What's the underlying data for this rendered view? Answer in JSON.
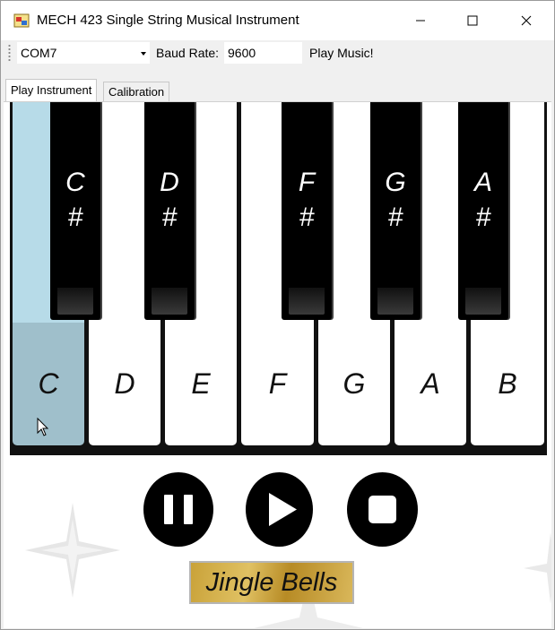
{
  "window": {
    "title": "MECH 423 Single String Musical Instrument",
    "minimize_icon": "minimize-icon",
    "maximize_icon": "maximize-icon",
    "close_icon": "close-icon"
  },
  "toolbar": {
    "port_value": "COM7",
    "baud_label": "Baud Rate:",
    "baud_value": "9600",
    "play_label": "Play Music!"
  },
  "tabs": [
    {
      "label": "Play Instrument",
      "active": true
    },
    {
      "label": "Calibration",
      "active": false
    }
  ],
  "keyboard": {
    "white_keys": [
      {
        "note": "C",
        "pressed": true
      },
      {
        "note": "D",
        "pressed": false
      },
      {
        "note": "E",
        "pressed": false
      },
      {
        "note": "F",
        "pressed": false
      },
      {
        "note": "G",
        "pressed": false
      },
      {
        "note": "A",
        "pressed": false
      },
      {
        "note": "B",
        "pressed": false
      }
    ],
    "black_keys": [
      {
        "note": "C",
        "sharp": "#"
      },
      {
        "note": "D",
        "sharp": "#"
      },
      {
        "note": "F",
        "sharp": "#"
      },
      {
        "note": "G",
        "sharp": "#"
      },
      {
        "note": "A",
        "sharp": "#"
      }
    ]
  },
  "controls": {
    "pause_icon": "pause-icon",
    "play_icon": "play-icon",
    "stop_icon": "stop-icon",
    "song_label": "Jingle Bells"
  },
  "colors": {
    "pressed_key": "#9fbfcb",
    "pressed_key_top": "#b7dbe8",
    "song_gold": "#c9a239"
  }
}
